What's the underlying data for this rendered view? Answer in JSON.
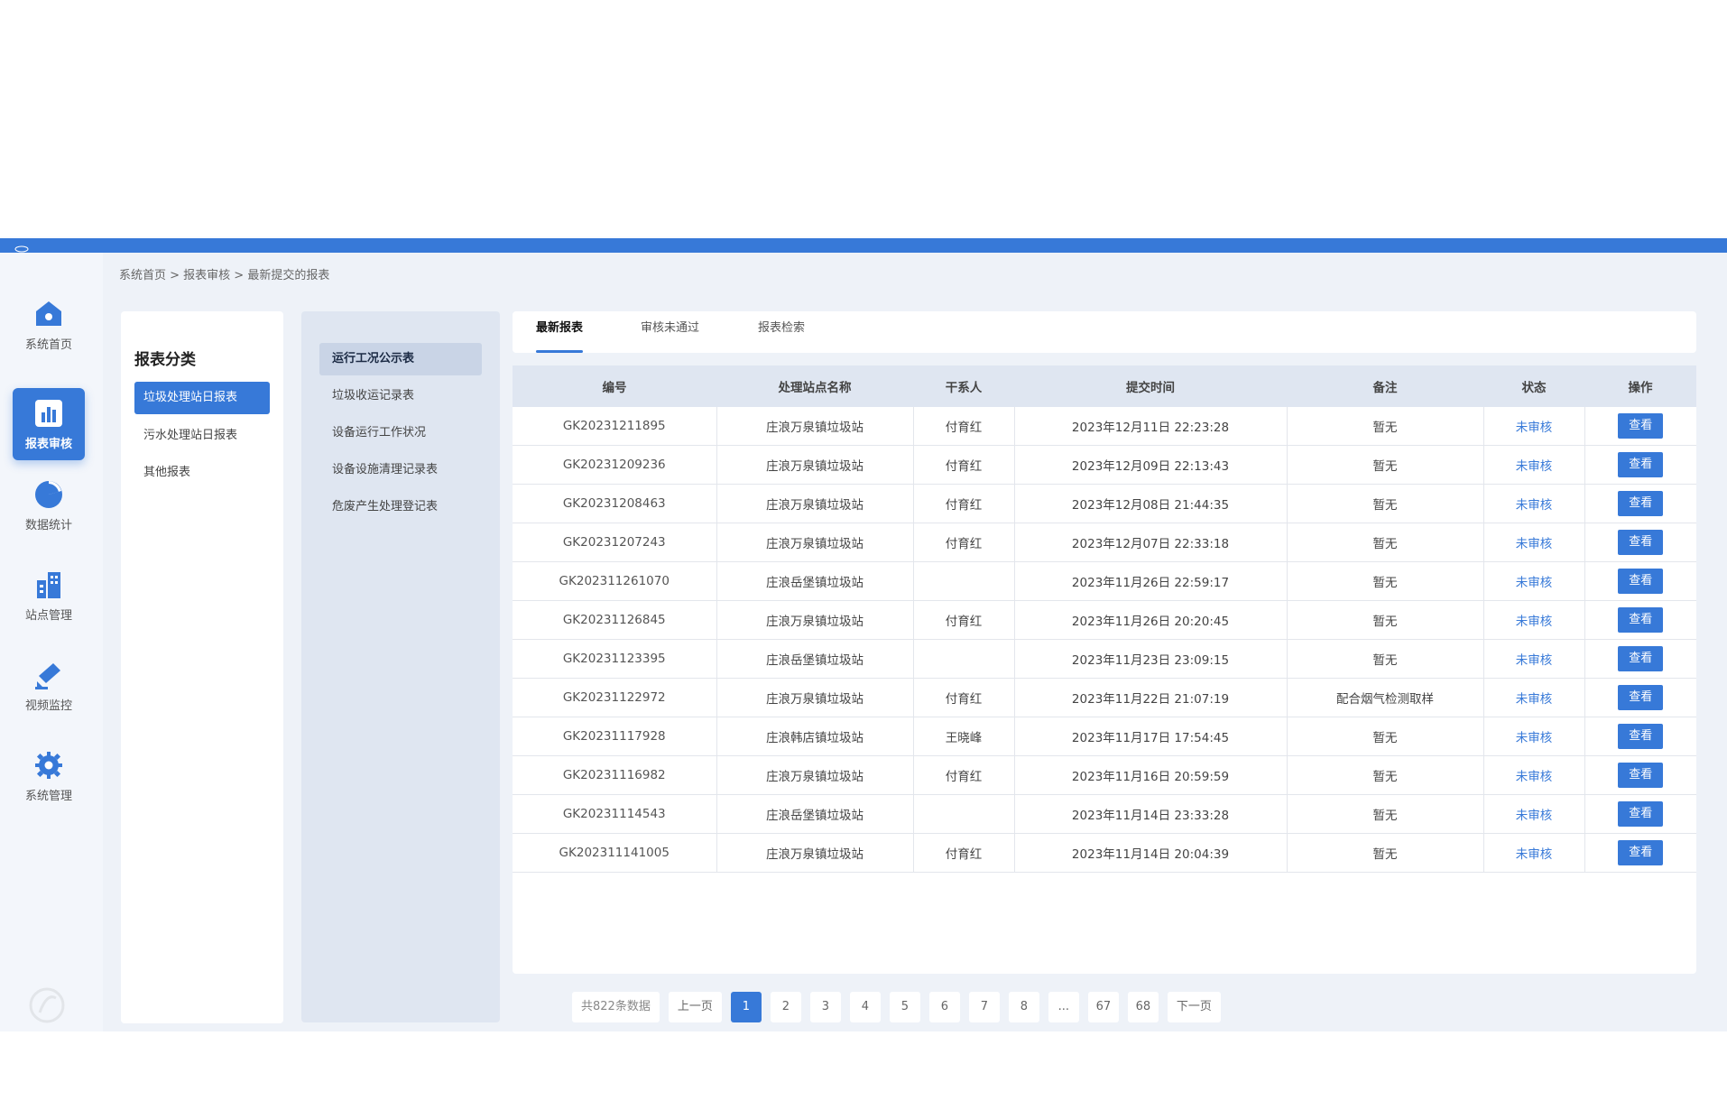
{
  "nav": [
    {
      "label": "系统首页",
      "icon": "home-icon"
    },
    {
      "label": "报表审核",
      "icon": "bar-chart-icon"
    },
    {
      "label": "数据统计",
      "icon": "pie-chart-icon"
    },
    {
      "label": "站点管理",
      "icon": "building-icon"
    },
    {
      "label": "视频监控",
      "icon": "camera-icon"
    },
    {
      "label": "系统管理",
      "icon": "gear-icon"
    }
  ],
  "breadcrumb": "系统首页 > 报表审核 > 最新提交的报表",
  "category": {
    "title": "报表分类",
    "items": [
      "垃圾处理站日报表",
      "污水处理站日报表",
      "其他报表"
    ]
  },
  "subcategories": [
    "运行工况公示表",
    "垃圾收运记录表",
    "设备运行工作状况",
    "设备设施清理记录表",
    "危废产生处理登记表"
  ],
  "tabs": [
    "最新报表",
    "审核未通过",
    "报表检索"
  ],
  "table": {
    "headers": [
      "编号",
      "处理站点名称",
      "干系人",
      "提交时间",
      "备注",
      "状态",
      "操作"
    ],
    "rows": [
      [
        "GK20231211895",
        "庄浪万泉镇垃圾站",
        "付育红",
        "2023年12月11日 22:23:28",
        "暂无",
        "未审核",
        "查看"
      ],
      [
        "GK20231209236",
        "庄浪万泉镇垃圾站",
        "付育红",
        "2023年12月09日 22:13:43",
        "暂无",
        "未审核",
        "查看"
      ],
      [
        "GK20231208463",
        "庄浪万泉镇垃圾站",
        "付育红",
        "2023年12月08日 21:44:35",
        "暂无",
        "未审核",
        "查看"
      ],
      [
        "GK20231207243",
        "庄浪万泉镇垃圾站",
        "付育红",
        "2023年12月07日 22:33:18",
        "暂无",
        "未审核",
        "查看"
      ],
      [
        "GK202311261070",
        "庄浪岳堡镇垃圾站",
        "",
        "2023年11月26日 22:59:17",
        "暂无",
        "未审核",
        "查看"
      ],
      [
        "GK20231126845",
        "庄浪万泉镇垃圾站",
        "付育红",
        "2023年11月26日 20:20:45",
        "暂无",
        "未审核",
        "查看"
      ],
      [
        "GK20231123395",
        "庄浪岳堡镇垃圾站",
        "",
        "2023年11月23日 23:09:15",
        "暂无",
        "未审核",
        "查看"
      ],
      [
        "GK20231122972",
        "庄浪万泉镇垃圾站",
        "付育红",
        "2023年11月22日 21:07:19",
        "配合烟气检测取样",
        "未审核",
        "查看"
      ],
      [
        "GK20231117928",
        "庄浪韩店镇垃圾站",
        "王晓峰",
        "2023年11月17日 17:54:45",
        "暂无",
        "未审核",
        "查看"
      ],
      [
        "GK20231116982",
        "庄浪万泉镇垃圾站",
        "付育红",
        "2023年11月16日 20:59:59",
        "暂无",
        "未审核",
        "查看"
      ],
      [
        "GK20231114543",
        "庄浪岳堡镇垃圾站",
        "",
        "2023年11月14日 23:33:28",
        "暂无",
        "未审核",
        "查看"
      ],
      [
        "GK202311141005",
        "庄浪万泉镇垃圾站",
        "付育红",
        "2023年11月14日 20:04:39",
        "暂无",
        "未审核",
        "查看"
      ]
    ]
  },
  "pagination": {
    "total": "共822条数据",
    "prev": "上一页",
    "pages": [
      "1",
      "2",
      "3",
      "4",
      "5",
      "6",
      "7",
      "8",
      "...",
      "67",
      "68"
    ],
    "current": "1",
    "next": "下一页"
  },
  "colors": {
    "accent": "#3779d8",
    "header_bg": "#dfe6f1",
    "page_bg": "#eef2f8"
  }
}
